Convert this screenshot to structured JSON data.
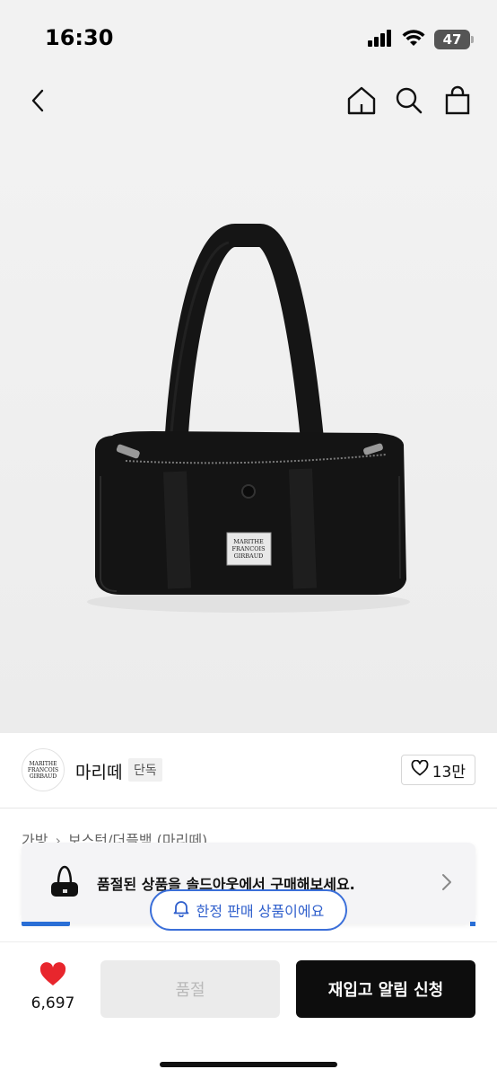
{
  "status_bar": {
    "time": "16:30",
    "battery": "47"
  },
  "nav": {
    "icons": [
      "chevron-left-icon",
      "home-icon",
      "search-icon",
      "shopping-bag-icon"
    ]
  },
  "product_image": {
    "label_lines": [
      "MARITHE",
      "FRANCOIS",
      "GIRBAUD"
    ]
  },
  "brand": {
    "name": "마리떼",
    "tag": "단독",
    "logo_lines": [
      "MARITHE",
      "FRANCOIS",
      "GIRBAUD"
    ],
    "likes": "13만"
  },
  "category": {
    "items": [
      "가방",
      "보스턴/더플백 (마리떼)"
    ]
  },
  "soldout_banner": {
    "text": "품절된 상품을 솔드아웃에서 구매해보세요."
  },
  "limited_pill": {
    "text": "한정 판매 상품이에요"
  },
  "bottom_bar": {
    "wish_count": "6,697",
    "soldout_label": "품절",
    "restock_label": "재입고 알림 신청"
  },
  "colors": {
    "accent_blue": "#2a6fd6",
    "heart_red": "#e8262d",
    "primary_black": "#0d0d0d"
  }
}
